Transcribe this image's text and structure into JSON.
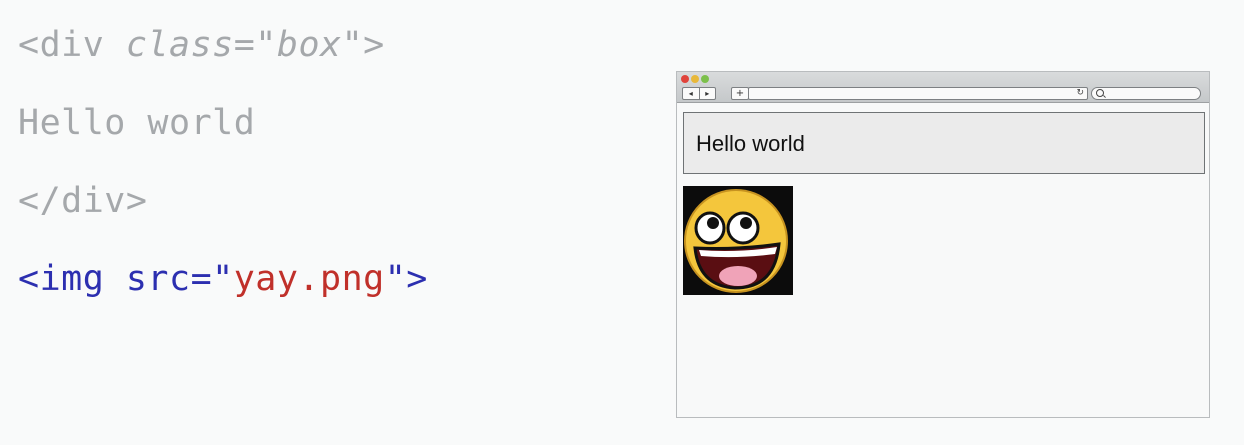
{
  "code": {
    "line1": {
      "open": "<div ",
      "attr": "class",
      "eq": "=\"",
      "value": "box",
      "close": "\">"
    },
    "line2": {
      "text": "Hello world"
    },
    "line3": {
      "text": "</div>"
    },
    "line4": {
      "open": "<img src=\"",
      "value": "yay.png",
      "close": "\">"
    }
  },
  "browser": {
    "nav_back": "◂",
    "nav_forward": "▸",
    "new_tab": "+",
    "reload": "↻",
    "box_text": "Hello world",
    "image_icon": "smiley-face-icon"
  },
  "colors": {
    "code_gray": "#a5a8ab",
    "code_blue": "#2c2fb0",
    "code_red": "#c0302a",
    "box_fill": "#ebebeb"
  }
}
